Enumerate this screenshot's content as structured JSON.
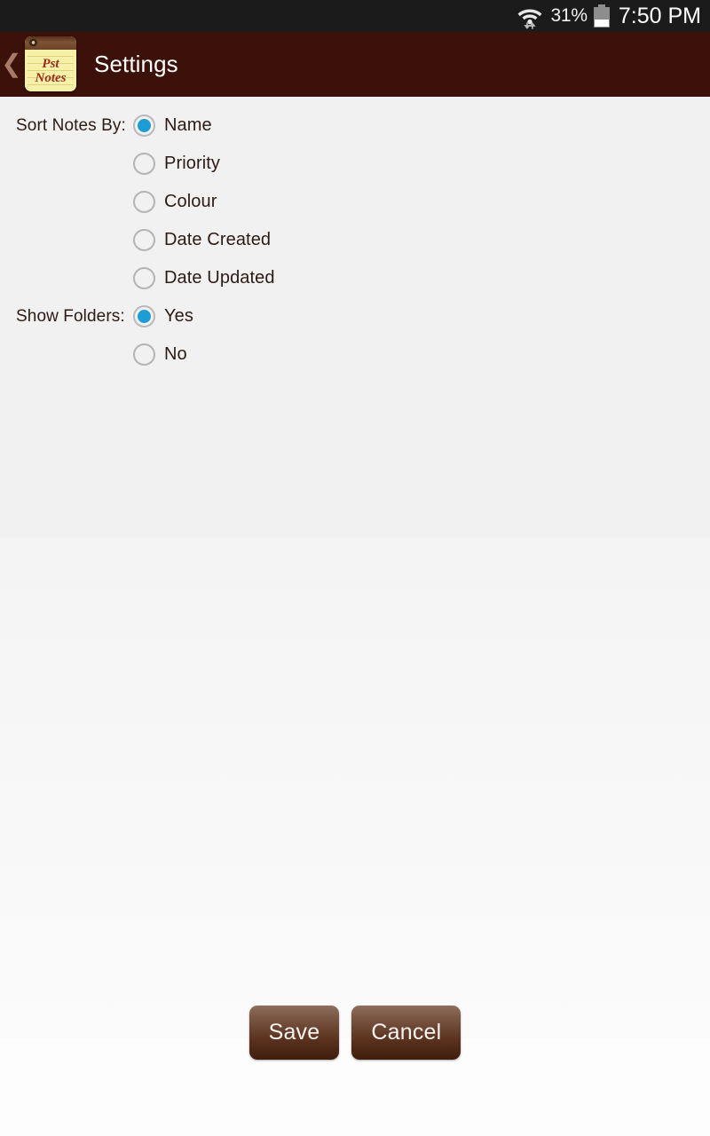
{
  "status_bar": {
    "wifi_icon": "wifi-icon",
    "data_transfer_icon": "data-transfer-arrows-icon",
    "battery_percent": "31%",
    "battery_icon": "battery-icon",
    "battery_level": 31,
    "time": "7:50 PM"
  },
  "action_bar": {
    "back_icon": "chevron-left-icon",
    "app_icon": "pst-notes-app-icon",
    "app_icon_text_line1": "Pst",
    "app_icon_text_line2": "Notes",
    "title": "Settings"
  },
  "settings": {
    "groups": [
      {
        "label": "Sort Notes By:",
        "name": "sort-notes-by",
        "options": [
          {
            "label": "Name",
            "selected": true
          },
          {
            "label": "Priority",
            "selected": false
          },
          {
            "label": "Colour",
            "selected": false
          },
          {
            "label": "Date Created",
            "selected": false
          },
          {
            "label": "Date Updated",
            "selected": false
          }
        ]
      },
      {
        "label": "Show Folders:",
        "name": "show-folders",
        "options": [
          {
            "label": "Yes",
            "selected": true
          },
          {
            "label": "No",
            "selected": false
          }
        ]
      }
    ]
  },
  "footer": {
    "save_label": "Save",
    "cancel_label": "Cancel"
  },
  "colors": {
    "status_bar_bg": "#1b1b1b",
    "action_bar_bg": "#3b1109",
    "content_bg": "#f1f1f1",
    "radio_selected": "#1d9dd4",
    "radio_ring": "#b4b4b4",
    "text_primary": "#2d1a12",
    "button_top": "#8f6e5d",
    "button_bottom": "#3f1d0d",
    "icon_paper": "#f6f0a8",
    "icon_script": "#9c2b14"
  }
}
